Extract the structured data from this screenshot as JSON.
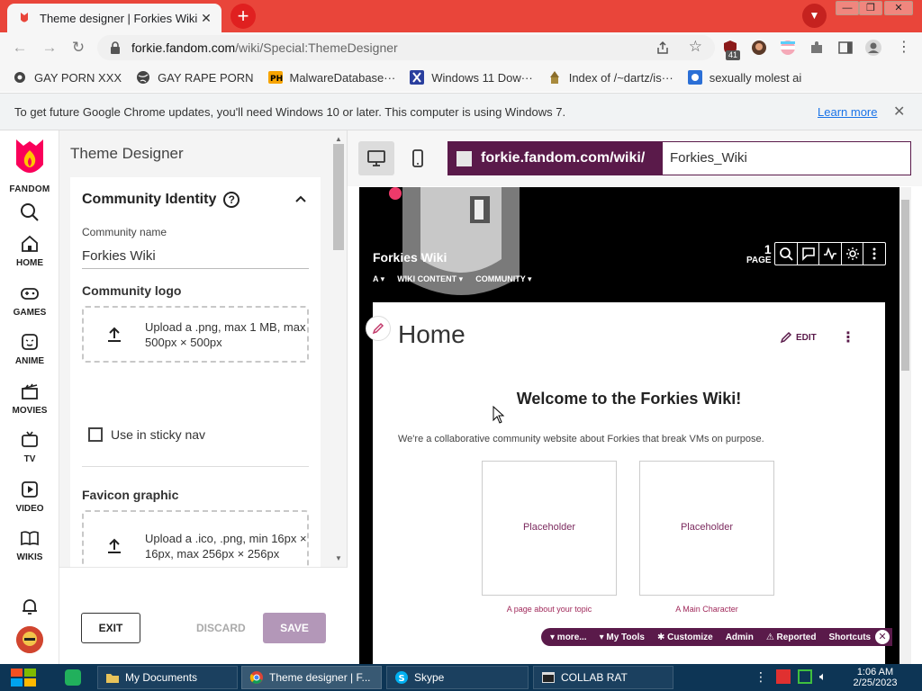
{
  "browser": {
    "tab_title": "Theme designer | Forkies Wiki",
    "url_host": "forkie.fandom.com",
    "url_path": "/wiki/Special:ThemeDesigner",
    "ext_badge": "41",
    "window_min": "—",
    "window_max": "❐",
    "window_close": "✕"
  },
  "bookmarks": [
    {
      "label": "GAY PORN XXX"
    },
    {
      "label": "GAY RAPE PORN"
    },
    {
      "label": "MalwareDatabase···"
    },
    {
      "label": "Windows 11 Dow···"
    },
    {
      "label": "Index of /~dartz/is···"
    },
    {
      "label": "sexually molest ai"
    }
  ],
  "infobar": {
    "message": "To get future Google Chrome updates, you'll need Windows 10 or later. This computer is using Windows 7.",
    "link": "Learn more"
  },
  "rail": {
    "brand": "FANDOM",
    "items": [
      {
        "label": "HOME",
        "icon": "home-icon"
      },
      {
        "label": "GAMES",
        "icon": "gamepad-icon"
      },
      {
        "label": "ANIME",
        "icon": "anime-icon"
      },
      {
        "label": "MOVIES",
        "icon": "clapper-icon"
      },
      {
        "label": "TV",
        "icon": "tv-icon"
      },
      {
        "label": "VIDEO",
        "icon": "video-icon"
      },
      {
        "label": "WIKIS",
        "icon": "book-icon"
      }
    ]
  },
  "designer": {
    "title": "Theme Designer",
    "section": "Community Identity",
    "community_name_label": "Community name",
    "community_name_value": "Forkies Wiki",
    "logo_label": "Community logo",
    "logo_upload": "Upload a .png, max 1 MB, max 500px × 500px",
    "sticky_label": "Use in sticky nav",
    "favicon_label": "Favicon graphic",
    "favicon_upload": "Upload a .ico, .png, min 16px × 16px, max 256px × 256px",
    "exit": "EXIT",
    "discard": "DISCARD",
    "save": "SAVE"
  },
  "preview": {
    "url_prefix": "forkie.fandom.com/wiki/",
    "page_input": "Forkies_Wiki",
    "wiki_name": "Forkies Wiki",
    "page_count": "1",
    "page_label": "PAGE",
    "nav": [
      "WIKI CONTENT ▾",
      "COMMUNITY ▾"
    ],
    "nav_first": "A ▾",
    "article_title": "Home",
    "edit_label": "EDIT",
    "welcome": "Welcome to the Forkies Wiki!",
    "description": "We're a collaborative community website about Forkies that break VMs on purpose.",
    "boxes": [
      {
        "placeholder": "Placeholder",
        "caption": "A page about your topic"
      },
      {
        "placeholder": "Placeholder",
        "caption": "A Main Character"
      }
    ],
    "toolbar": [
      "▾ more...",
      "▾ My Tools",
      "✱ Customize",
      "Admin",
      "⚠ Reported",
      "Shortcuts"
    ]
  },
  "taskbar": {
    "items": [
      "My Documents",
      "Theme designer | F...",
      "Skype",
      "COLLAB RAT"
    ],
    "time": "1:06 AM",
    "date": "2/25/2023"
  },
  "colors": {
    "fandom_purple": "#5a1a4a",
    "chrome_frame": "#e9453a",
    "save_button": "#b397b8"
  }
}
